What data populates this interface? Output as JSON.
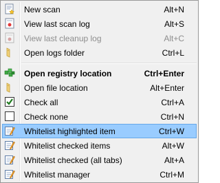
{
  "menu": {
    "items": [
      {
        "label": "New scan",
        "shortcut": "Alt+N",
        "icon": "new-scan-icon"
      },
      {
        "label": "View last scan log",
        "shortcut": "Alt+S",
        "icon": "scan-log-icon"
      },
      {
        "label": "View last cleanup log",
        "shortcut": "Alt+C",
        "icon": "cleanup-log-icon",
        "disabled": true
      },
      {
        "label": "Open logs folder",
        "shortcut": "Ctrl+L",
        "icon": "folder-icon"
      },
      {
        "label": "Open registry location",
        "shortcut": "Ctrl+Enter",
        "icon": "registry-icon",
        "bold": true
      },
      {
        "label": "Open file location",
        "shortcut": "Alt+Enter",
        "icon": "folder-icon"
      },
      {
        "label": "Check all",
        "shortcut": "Ctrl+A",
        "icon": "checkbox-checked-icon"
      },
      {
        "label": "Check none",
        "shortcut": "Ctrl+N",
        "icon": "checkbox-empty-icon"
      },
      {
        "label": "Whitelist highlighted item",
        "shortcut": "Ctrl+W",
        "icon": "whitelist-icon",
        "highlighted": true
      },
      {
        "label": "Whitelist checked items",
        "shortcut": "Alt+W",
        "icon": "whitelist-icon"
      },
      {
        "label": "Whitelist checked (all tabs)",
        "shortcut": "Alt+A",
        "icon": "whitelist-icon"
      },
      {
        "label": "Whitelist manager",
        "shortcut": "Ctrl+M",
        "icon": "whitelist-icon"
      }
    ]
  },
  "colors": {
    "highlight": "#99ccff",
    "disabled_text": "#8d8d8d",
    "menu_background": "#f0f0f0"
  }
}
